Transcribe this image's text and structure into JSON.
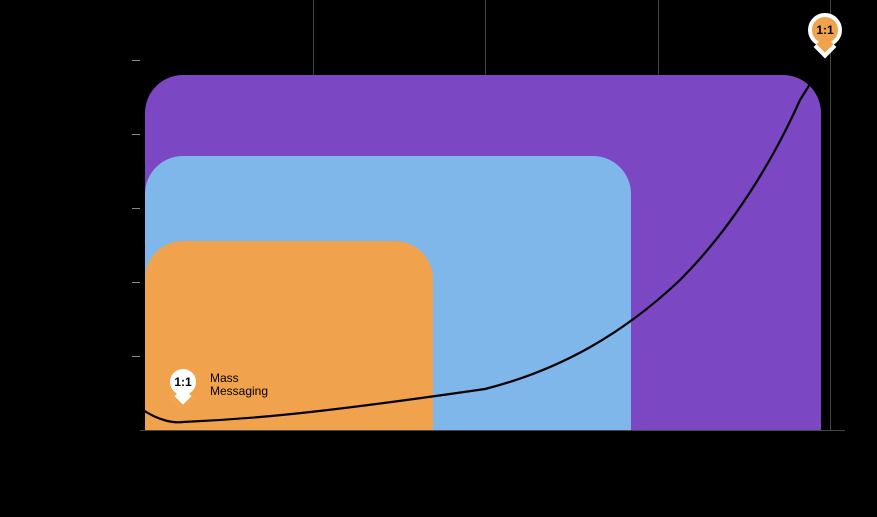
{
  "chart_data": {
    "type": "area",
    "title": "",
    "xlabel": "",
    "ylabel": "",
    "xlim": [
      0,
      4
    ],
    "ylim": [
      0,
      5
    ],
    "zones": [
      {
        "name": "outer",
        "color": "#7b47c2",
        "x0": 0.03,
        "x1": 3.95,
        "y0": 0.0,
        "y1": 4.8
      },
      {
        "name": "middle",
        "color": "#7fb7eb",
        "x0": 0.03,
        "x1": 2.85,
        "y0": 0.0,
        "y1": 3.7
      },
      {
        "name": "inner",
        "color": "#f0a24c",
        "x0": 0.03,
        "x1": 1.7,
        "y0": 0.0,
        "y1": 2.55
      }
    ],
    "curve": {
      "points": [
        {
          "x": 0.0,
          "y": 0.3
        },
        {
          "x": 0.25,
          "y": 0.1
        },
        {
          "x": 1.0,
          "y": 0.15
        },
        {
          "x": 2.0,
          "y": 0.55
        },
        {
          "x": 2.8,
          "y": 1.3
        },
        {
          "x": 3.4,
          "y": 2.6
        },
        {
          "x": 3.8,
          "y": 4.2
        },
        {
          "x": 3.97,
          "y": 5.0
        }
      ]
    },
    "markers": {
      "start": {
        "x": 0.25,
        "y": 0.65,
        "label": "1:1",
        "caption": "Mass\nMessaging"
      },
      "end": {
        "x": 3.97,
        "y": 5.55,
        "label": "1:1"
      }
    },
    "grid": {
      "v": [
        1,
        2,
        3,
        4
      ],
      "h_ticks": [
        1,
        2,
        3,
        4,
        5
      ]
    }
  }
}
